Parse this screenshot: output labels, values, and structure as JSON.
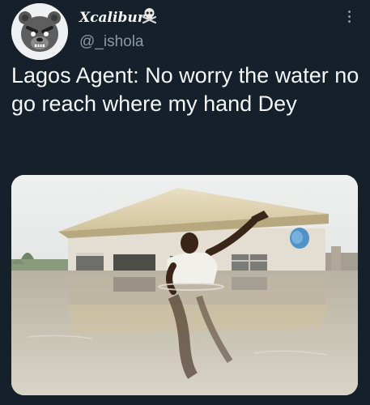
{
  "author": {
    "display_name": "Xcalibur",
    "name_emoji": "skull-and-crossbones-icon",
    "handle": "@_ishola",
    "avatar_icon": "angry-bear-avatar-icon"
  },
  "menu": {
    "icon": "more-vertical-icon"
  },
  "tweet": {
    "text": "Lagos Agent: No worry the water no go reach where my hand Dey"
  },
  "media": {
    "type": "photo",
    "icon": "flooded-house-photo"
  },
  "colors": {
    "background": "#15202b",
    "text": "#e7e9ea",
    "secondary_text": "#8b98a5"
  }
}
